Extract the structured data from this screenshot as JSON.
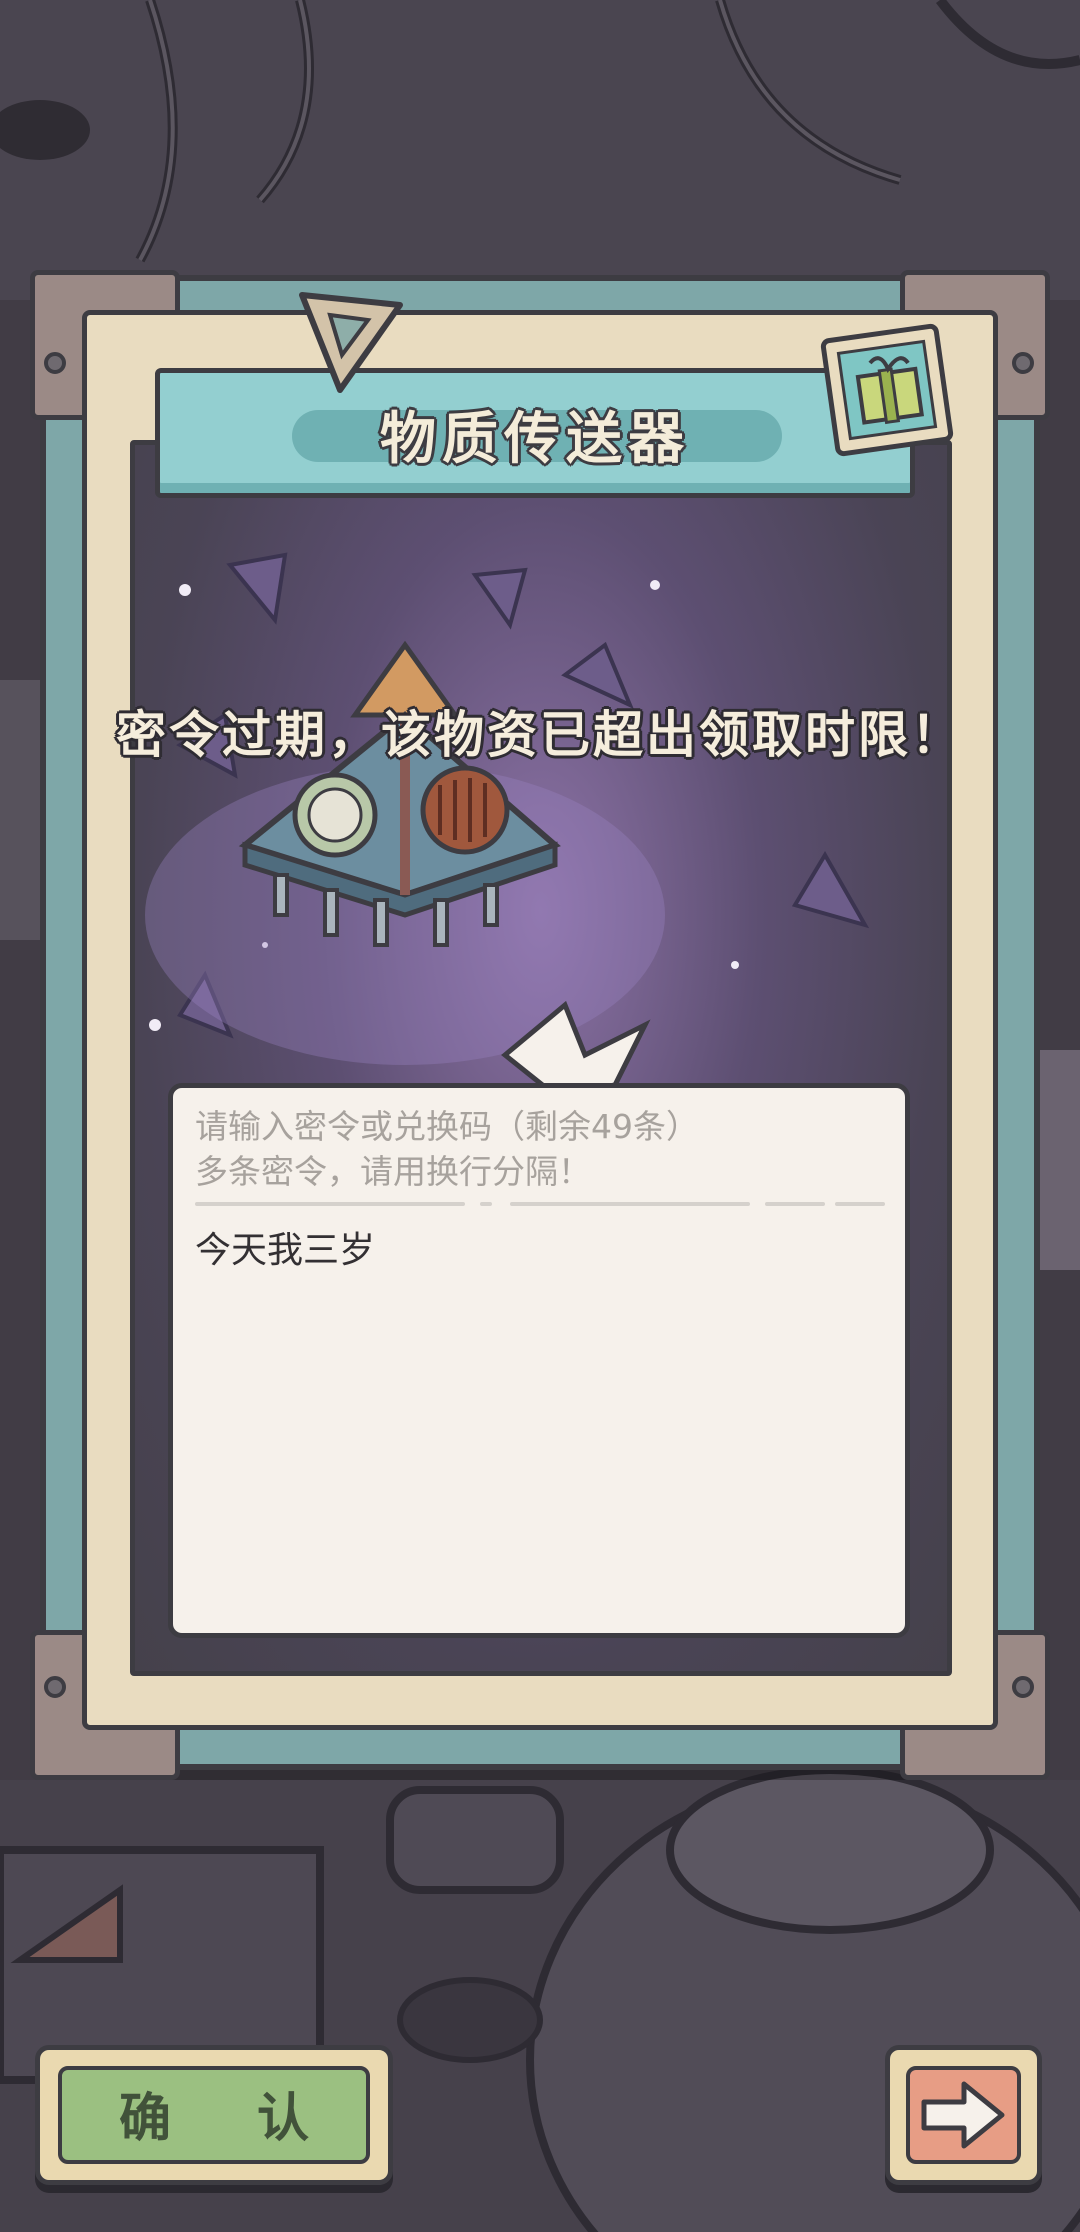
{
  "dialog": {
    "title": "物质传送器",
    "message": "密令过期，该物资已超出领取时限！"
  },
  "redeem": {
    "placeholder_line1": "请输入密令或兑换码（剩余49条）",
    "placeholder_line2": "多条密令，请用换行分隔！",
    "value": "今天我三岁"
  },
  "buttons": {
    "confirm_label": "确 认",
    "next_icon": "arrow-right-icon"
  },
  "decor": {
    "gift_icon": "gift-stamp-icon",
    "device": "matter-transporter-pyramid"
  },
  "colors": {
    "panel_teal": "#7ea7a8",
    "banner_teal": "#93cfd0",
    "confirm_green": "#9bc081",
    "next_orange": "#e79d85",
    "card_bg": "#f6f1eb"
  }
}
